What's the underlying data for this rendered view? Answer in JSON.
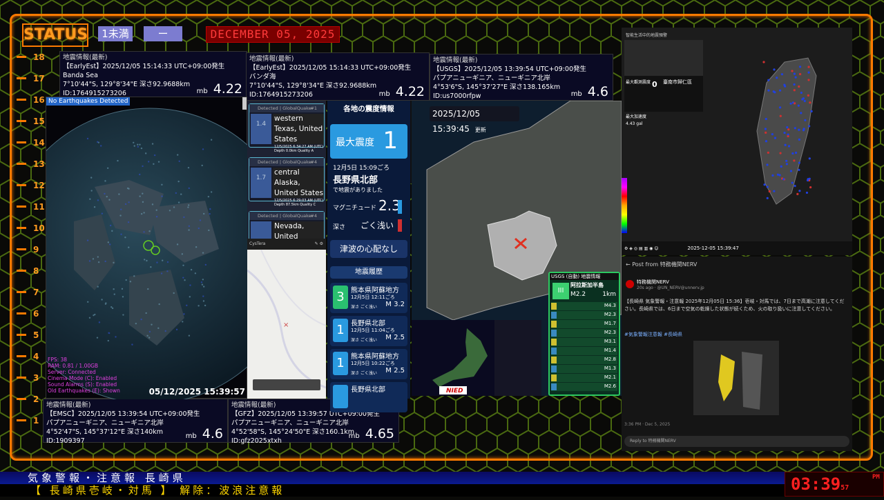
{
  "header": {
    "status_label": "STATUS",
    "tag1": "1未満",
    "tag2": "ー",
    "date": "DECEMBER 05, 2025",
    "corner": "26"
  },
  "ruler": [
    "18",
    "17",
    "16",
    "15",
    "14",
    "13",
    "12",
    "11",
    "10",
    "9",
    "8",
    "7",
    "6",
    "5",
    "4",
    "3",
    "2",
    "1"
  ],
  "quake_panels": [
    {
      "id": "p1",
      "title": "地震情報(最新)",
      "source": "【EarlyEst】2025/12/05 15:14:33 UTC+09:00発生",
      "region": "Banda Sea",
      "coords": "7°10'44\"S, 129°8'34\"E  深さ92.9688km",
      "qid": "ID:1764915273206",
      "mb": "mb",
      "mag": "4.22"
    },
    {
      "id": "p2",
      "title": "地震情報(最新)",
      "source": "【EarlyEst】2025/12/05 15:14:33 UTC+09:00発生",
      "region": "バンダ海",
      "coords": "7°10'44\"S, 129°8'34\"E  深さ92.9688km",
      "qid": "ID:1764915273206",
      "mb": "mb",
      "mag": "4.22"
    },
    {
      "id": "p3",
      "title": "地震情報(最新)",
      "source": "【USGS】2025/12/05 13:39:54 UTC+09:00発生",
      "region": "パプアニューギニア、ニューギニア北岸",
      "coords": "4°53'6\"S, 145°37'27\"E  深さ138.165km",
      "qid": "ID:us7000rfpw",
      "mb": "mb",
      "mag": "4.6"
    },
    {
      "id": "p4",
      "title": "地震情報(最新)",
      "source": "【EMSC】2025/12/05 13:39:54 UTC+09:00発生",
      "region": "パプアニューギニア、ニューギニア北岸",
      "coords": "4°52'47\"S, 145°37'12\"E  深さ140km",
      "qid": "ID:1909397",
      "mb": "mb",
      "mag": "4.6"
    },
    {
      "id": "p5",
      "title": "地震情報(最新)",
      "source": "【GFZ】2025/12/05 13:39:57 UTC+09:00発生",
      "region": "パプアニューギニア、ニューギニア北岸",
      "coords": "4°52'58\"S, 145°24'50\"E  深さ160.1km",
      "qid": "ID:gfz2025xtxh",
      "mb": "mb",
      "mag": "4.65"
    }
  ],
  "globe": {
    "label": "No Earthquakes Detected",
    "timestamp": "05/12/2025 15:39:57",
    "stats": [
      {
        "text": "FPS: 38",
        "color": "#e040e0"
      },
      {
        "text": "RAM: 0.81 / 1.00GB",
        "color": "#e040e0"
      },
      {
        "text": "Server: Connected",
        "color": "#e040e0"
      },
      {
        "text": "Cinema Mode (C): Enabled",
        "color": "#e040e0"
      },
      {
        "text": "Sound Alarms (S): Enabled",
        "color": "#e040e0"
      },
      {
        "text": "Old Earthquakes (E): Shown",
        "color": "#e040e0"
      }
    ]
  },
  "feed": {
    "cards": [
      {
        "head": "Detected | GlobalQuake",
        "num": "#1",
        "mag": "1.4",
        "place": "western Texas, United States",
        "meta": "12/5/2025 6:34:27 AM (UTC)  Depth 0.0km  Quality A"
      },
      {
        "head": "Detected | GlobalQuake",
        "num": "#4",
        "mag": "1.7",
        "place": "central Alaska, United States",
        "meta": "12/5/2025 6:29:03 AM (UTC)  Depth 87.5km  Quality C"
      },
      {
        "head": "Detected | GlobalQuake",
        "num": "#4",
        "mag": "",
        "place": "Nevada, United",
        "meta": ""
      }
    ],
    "app": "CysTera"
  },
  "shindo": {
    "header": "各地の震度情報",
    "max_label": "最大震度",
    "max_value": "1",
    "time": "12月5日 15:09ごろ",
    "place": "長野県北部",
    "occurred": "で地震がありました",
    "mag_label": "マグニチュード",
    "mag": "2.3",
    "depth_label": "深さ",
    "depth": "ごく浅い",
    "tsunami": "津波の心配なし",
    "history_header": "地震履歴",
    "history": [
      {
        "shindo": "3",
        "place": "熊本県阿蘇地方",
        "time": "12月5日 12:11ごろ",
        "depth": "深さ ごく浅い",
        "mag": "M 3.2"
      },
      {
        "shindo": "1",
        "place": "長野県北部",
        "time": "12月5日 11:04ごろ",
        "depth": "深さ ごく浅い",
        "mag": "M 2.5"
      },
      {
        "shindo": "1",
        "place": "熊本県阿蘇地方",
        "time": "12月5日 10:22ごろ",
        "depth": "深さ ごく浅い",
        "mag": "M 2.5"
      },
      {
        "shindo": "",
        "place": "長野県北部",
        "time": "",
        "depth": "",
        "mag": ""
      }
    ]
  },
  "jmap": {
    "timestamp": "2025/12/05 15:39:45",
    "update": "更新",
    "nied": "NIED",
    "usgs": {
      "title": "USGS (自動) 地震情報",
      "region": "阿拉斯加半島",
      "mag": "M2.2",
      "depth": "1km",
      "shindo": "III",
      "list": [
        "M4.3",
        "M2.3",
        "M1.7",
        "M2.3",
        "M3.1",
        "M1.4",
        "M2.8",
        "M1.3",
        "M2.1",
        "M2.6"
      ]
    }
  },
  "twp": {
    "title": "智能生活中的地震預警",
    "location": "臺南市歸仁區",
    "max_label": "最大觀測震度",
    "max_val": "0",
    "pga_label": "最大加速度",
    "pga": "4.43 gal",
    "time": "2025-12-05 15:39:47",
    "scale": "7"
  },
  "nerv": {
    "back": "Post from 特務機関NERV",
    "account": "特務機関NERV",
    "handle": "20s ago · @UN_NERV@unnerv.jp",
    "body": "【長崎県 気象警報・注意報 2025年12月05日 15:36】壱岐・対馬では、7日まで高潮に注意してください。長崎県では、6日まで空気の乾燥した状態が続くため、火の取り扱いに注意してください。",
    "tags": "#気象警報注意報 #長崎県",
    "footer": "3:36 PM · Dec 5, 2025",
    "reply": "Reply to 特務機関NERV"
  },
  "ticker": {
    "line1": "気象警報・注意報 長崎県",
    "line2": "【 長崎県壱岐・対馬 】 解除：波浪注意報"
  },
  "clock": {
    "time": "03:39",
    "sec": "57",
    "ampm": "PM"
  }
}
